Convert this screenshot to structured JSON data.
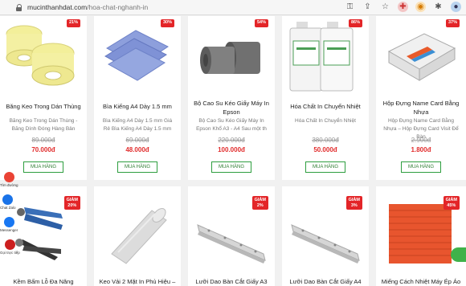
{
  "browser": {
    "domain": "mucinthanhdat.com",
    "path": "/hoa-chat-nghanh-in",
    "icons": [
      "lock-icon",
      "key-icon",
      "share-icon",
      "star-icon",
      "shield-icon",
      "globe-icon",
      "puzzle-icon",
      "profile-icon"
    ]
  },
  "products_row1": [
    {
      "title": "Băng Keo Trong Dán Thùng",
      "desc": "Băng Keo Trong Dán Thùng - Băng Dính Đóng Hàng Bản",
      "old_price": "89.000đ",
      "price": "70.000đ",
      "badge": "21%",
      "buy": "MUA HÀNG"
    },
    {
      "title": "Bìa Kiếng A4 Dày 1.5 mm",
      "desc": "Bìa Kiếng A4 Dày 1.5 mm Giá Rẻ Bìa Kiếng A4 Dày 1.5 mm",
      "old_price": "69.000đ",
      "price": "48.000đ",
      "badge": "30%",
      "buy": "MUA HÀNG"
    },
    {
      "title": "Bộ Cao Su Kéo Giấy Máy In Epson",
      "desc": "Bộ Cao Su Kéo Giấy Máy In Epson Khổ A3 - A4 Sau một th",
      "old_price": "220.000đ",
      "price": "100.000đ",
      "badge": "54%",
      "buy": "MUA HÀNG"
    },
    {
      "title": "Hóa Chất In Chuyển Nhiệt",
      "desc": "Hóa Chất In Chuyển Nhiệt",
      "old_price": "380.000đ",
      "price": "50.000đ",
      "badge": "86%",
      "buy": "MUA HÀNG"
    },
    {
      "title": "Hộp Đựng Name Card Bằng Nhựa",
      "desc": "Hộp Đựng Name Card Bằng Nhựa – Hộp Đựng Card Visit Để Bàn",
      "old_price": "2.900đ",
      "price": "1.800đ",
      "badge": "37%",
      "buy": "MUA HÀNG"
    }
  ],
  "products_row2": [
    {
      "title": "Kềm Bấm Lỗ Đa Năng",
      "badge_top": "GIẢM",
      "badge_val": "20%"
    },
    {
      "title": "Keo Vải 2 Mặt In Phủ Hiệu –",
      "badge_top": "",
      "badge_val": ""
    },
    {
      "title": "Lưỡi Dao Bàn Cắt Giấy A3",
      "badge_top": "GIẢM",
      "badge_val": "2%"
    },
    {
      "title": "Lưỡi Dao Bàn Cắt Giấy A4",
      "badge_top": "GIẢM",
      "badge_val": "3%"
    },
    {
      "title": "Miếng Cách Nhiệt Máy Ép Áo",
      "badge_top": "GIẢM",
      "badge_val": "45%"
    }
  ],
  "side_contacts": [
    {
      "label": "Tìm đường",
      "color": "#ea4335"
    },
    {
      "label": "Chat Zalo",
      "color": "#1a73e8"
    },
    {
      "label": "Messenger",
      "color": "#1877f2"
    },
    {
      "label": "Gọi trực tiếp",
      "color": "#cc1f1f"
    }
  ]
}
